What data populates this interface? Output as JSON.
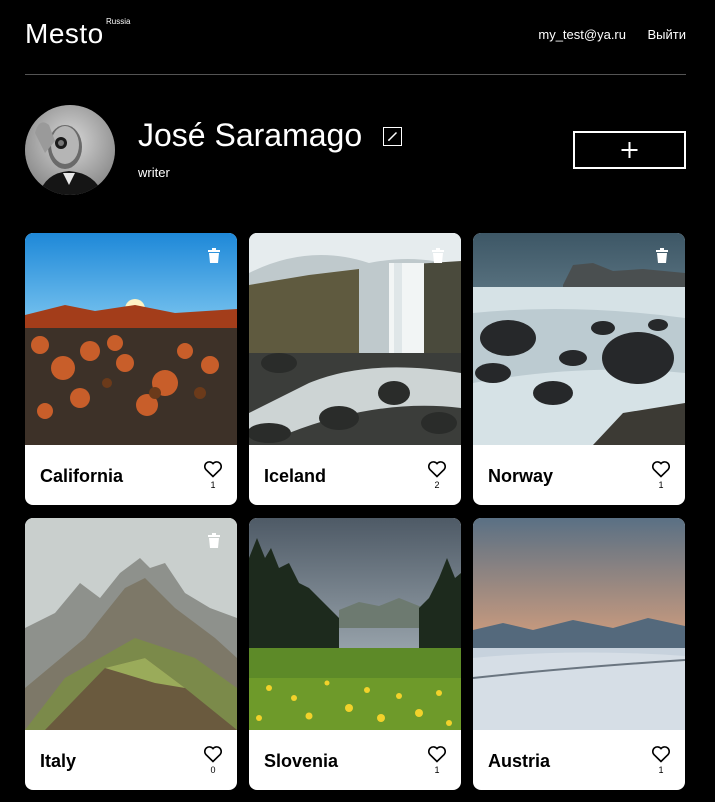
{
  "header": {
    "logo": "Mesto",
    "logo_sup": "Russia",
    "email": "my_test@ya.ru",
    "logout_label": "Выйти"
  },
  "profile": {
    "name": "José Saramago",
    "about": "writer",
    "avatar_icon": "person-portrait-photo",
    "edit_icon": "pencil-icon",
    "add_icon": "plus-icon"
  },
  "cards": [
    {
      "title": "California",
      "likes": "1",
      "deletable": true
    },
    {
      "title": "Iceland",
      "likes": "2",
      "deletable": true
    },
    {
      "title": "Norway",
      "likes": "1",
      "deletable": true
    },
    {
      "title": "Italy",
      "likes": "0",
      "deletable": true
    },
    {
      "title": "Slovenia",
      "likes": "1",
      "deletable": false
    },
    {
      "title": "Austria",
      "likes": "1",
      "deletable": false
    }
  ],
  "colors": {
    "background": "#000000",
    "card": "#ffffff",
    "divider": "#545454"
  }
}
